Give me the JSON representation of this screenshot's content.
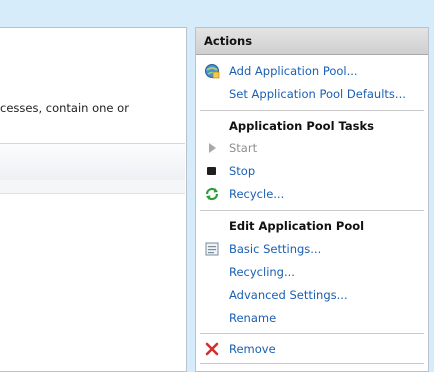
{
  "main": {
    "description": "cesses, contain one or"
  },
  "actions": {
    "title": "Actions",
    "add_pool": "Add Application Pool...",
    "set_defaults": "Set Application Pool Defaults...",
    "tasks_title": "Application Pool Tasks",
    "start": "Start",
    "stop": "Stop",
    "recycle": "Recycle...",
    "edit_title": "Edit Application Pool",
    "basic_settings": "Basic Settings...",
    "recycling": "Recycling...",
    "advanced_settings": "Advanced Settings...",
    "rename": "Rename",
    "remove": "Remove"
  },
  "colors": {
    "link": "#1a5fb4",
    "disabled": "#8f8f8f",
    "background": "#d6ecfb"
  }
}
